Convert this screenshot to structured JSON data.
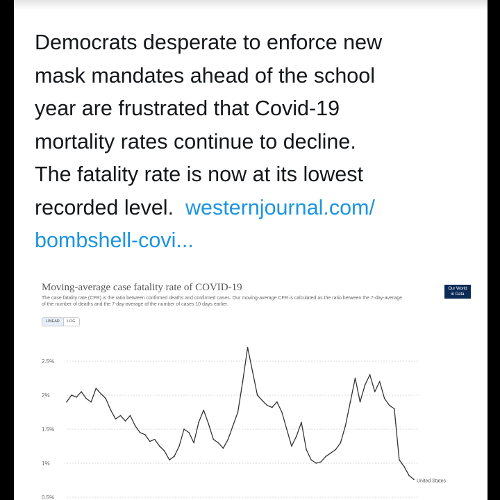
{
  "tweet": {
    "lines": [
      "Democrats desperate to enforce new",
      "mask mandates ahead of the school",
      "year are frustrated that Covid-19",
      "mortality rates continue to decline.",
      "The fatality rate is now at its lowest"
    ],
    "line6_text": "recorded level.",
    "link_part1": "westernjournal.com/",
    "link_part2": "bombshell-covi..."
  },
  "logo": {
    "line1": "Our World",
    "line2": "in Data"
  },
  "toggle": {
    "linear": "LINEAR",
    "log": "LOG"
  },
  "chart_data": {
    "type": "line",
    "title": "Moving-average case fatality rate of COVID-19",
    "subtitle": "The case fatality rate (CFR) is the ratio between confirmed deaths and confirmed cases. Our moving-average CFR is calculated as the ratio between the 7-day-average of the number of deaths and the 7-day-average of the number of cases 10 days earlier.",
    "xlabel": "",
    "ylabel": "",
    "y_scale": "linear",
    "ylim": [
      0.5,
      3.0
    ],
    "ytick_labels": [
      "0.5%",
      "1%",
      "1.5%",
      "2%",
      "2.5%"
    ],
    "ytick_values": [
      0.5,
      1.0,
      1.5,
      2.0,
      2.5
    ],
    "grid": true,
    "series": [
      {
        "name": "United States",
        "color": "#333333",
        "values": [
          1.9,
          2.0,
          1.97,
          2.05,
          1.95,
          1.9,
          2.1,
          2.02,
          1.95,
          1.78,
          1.65,
          1.7,
          1.62,
          1.7,
          1.55,
          1.45,
          1.42,
          1.32,
          1.35,
          1.25,
          1.18,
          1.05,
          1.1,
          1.25,
          1.5,
          1.45,
          1.3,
          1.6,
          1.78,
          1.58,
          1.35,
          1.3,
          1.22,
          1.35,
          1.55,
          1.75,
          2.2,
          2.7,
          2.35,
          2.0,
          1.92,
          1.85,
          1.82,
          1.9,
          1.75,
          1.5,
          1.25,
          1.4,
          1.6,
          1.2,
          1.05,
          1.0,
          1.02,
          1.1,
          1.15,
          1.2,
          1.3,
          1.55,
          1.9,
          2.25,
          1.9,
          2.15,
          2.3,
          2.05,
          2.2,
          1.95,
          1.85,
          1.8,
          1.05,
          0.95,
          0.82,
          0.76
        ]
      }
    ]
  }
}
